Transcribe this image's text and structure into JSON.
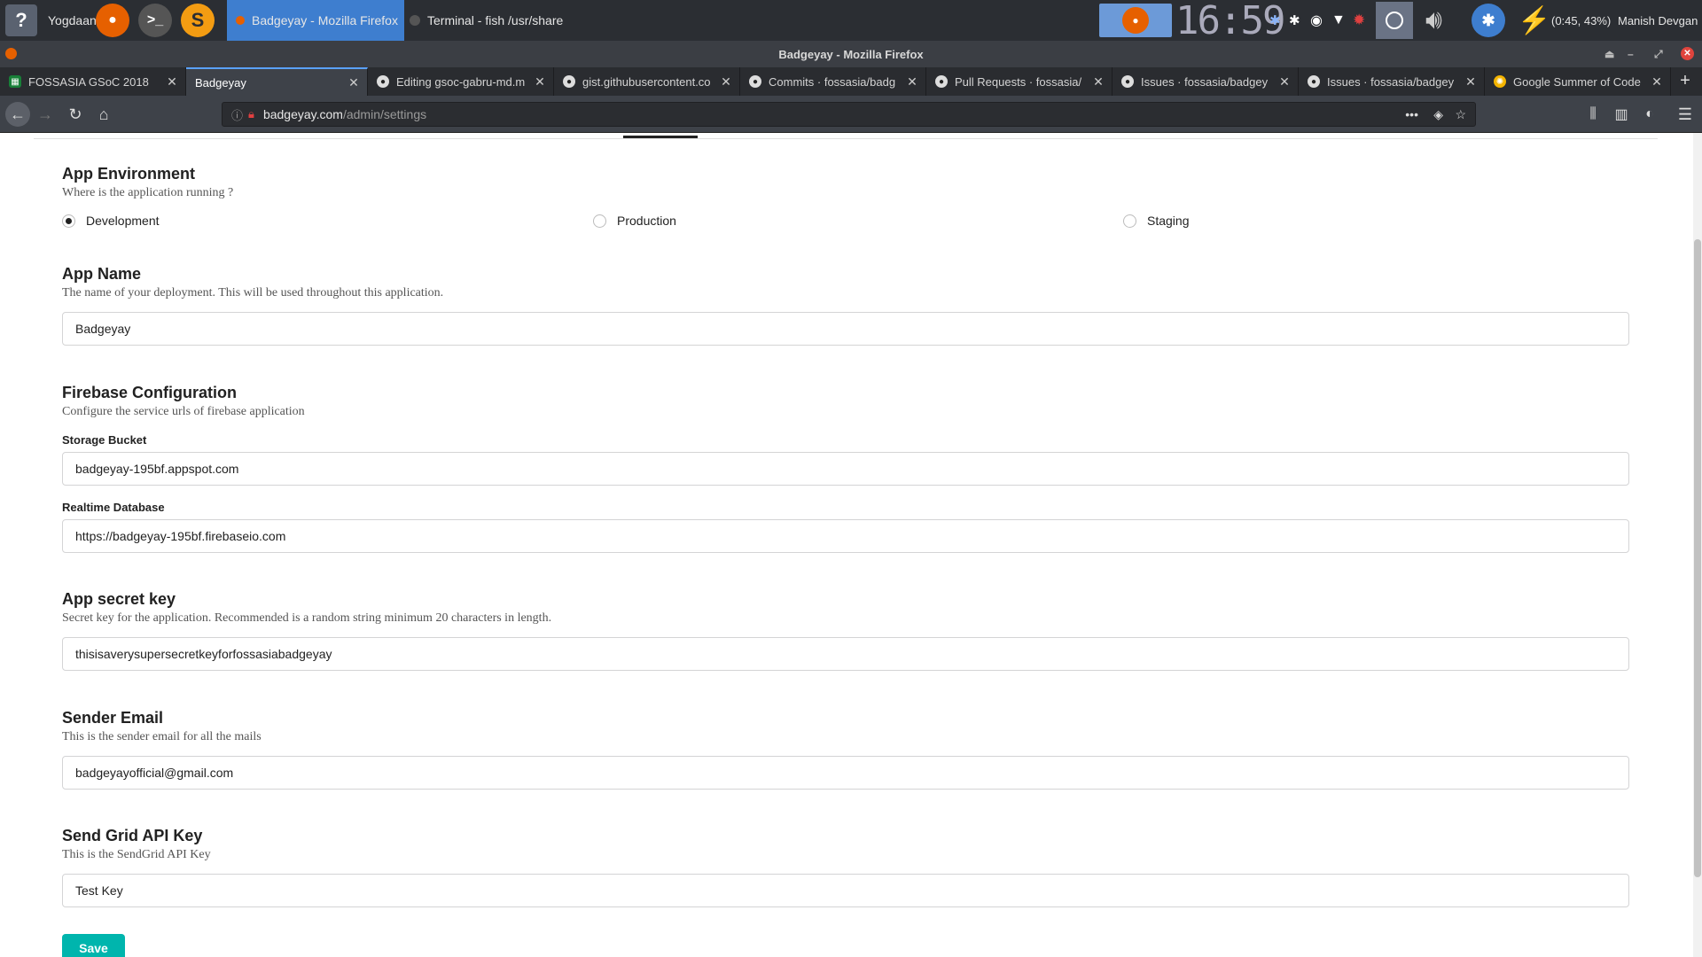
{
  "os_panel": {
    "user_label": "Yogdaan",
    "tasks": [
      {
        "label": "Badgeyay - Mozilla Firefox"
      },
      {
        "label": "Terminal - fish  /usr/share"
      }
    ],
    "clock": "16:59",
    "battery": "(0:45, 43%)",
    "username": "Manish Devgan"
  },
  "window": {
    "title": "Badgeyay - Mozilla Firefox"
  },
  "tabs": [
    {
      "label": "FOSSASIA GSoC 2018"
    },
    {
      "label": "Badgeyay"
    },
    {
      "label": "Editing gsoc-gabru-md.m"
    },
    {
      "label": "gist.githubusercontent.co"
    },
    {
      "label": "Commits · fossasia/badg"
    },
    {
      "label": "Pull Requests · fossasia/"
    },
    {
      "label": "Issues · fossasia/badgey"
    },
    {
      "label": "Issues · fossasia/badgey"
    },
    {
      "label": "Google Summer of Code"
    }
  ],
  "url": {
    "host": "badgeyay.com",
    "path": "/admin/settings"
  },
  "settings": {
    "env": {
      "title": "App Environment",
      "desc": "Where is the application running ?",
      "options": [
        "Development",
        "Production",
        "Staging"
      ],
      "selected": "Development"
    },
    "app_name": {
      "title": "App Name",
      "desc": "The name of your deployment. This will be used throughout this application.",
      "value": "Badgeyay"
    },
    "firebase": {
      "title": "Firebase Configuration",
      "desc": "Configure the service urls of firebase application",
      "storage_label": "Storage Bucket",
      "storage_value": "badgeyay-195bf.appspot.com",
      "db_label": "Realtime Database",
      "db_value": "https://badgeyay-195bf.firebaseio.com"
    },
    "secret": {
      "title": "App secret key",
      "desc": "Secret key for the application. Recommended is a random string minimum 20 characters in length.",
      "value": "thisisaverysupersecretkeyforfossasiabadgeyay"
    },
    "sender": {
      "title": "Sender Email",
      "desc": "This is the sender email for all the mails",
      "value": "badgeyayofficial@gmail.com"
    },
    "sendgrid": {
      "title": "Send Grid API Key",
      "desc": "This is the SendGrid API Key",
      "value": "Test Key"
    },
    "save_label": "Save"
  },
  "colors": {
    "accent": "#00b5ad",
    "panel": "#2b2e33",
    "active_task": "#3e7ecf"
  }
}
